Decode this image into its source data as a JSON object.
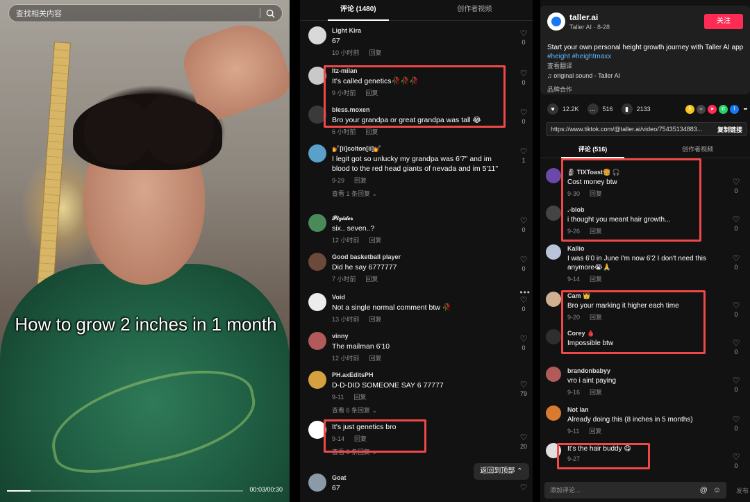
{
  "video": {
    "search_placeholder": "查找相关内容",
    "caption": "How to grow 2 inches in 1 month",
    "time": "00:03/00:30",
    "progress_fraction": 0.1
  },
  "mid": {
    "tabs": [
      {
        "label": "评论 (1480)",
        "active": true
      },
      {
        "label": "创作者视频",
        "active": false
      }
    ],
    "reply_label": "回复",
    "comments": [
      {
        "user": "Light Kira",
        "text": "67",
        "time": "10 小时前",
        "likes": "0",
        "avatar_color": "#d9d9d9"
      },
      {
        "user": "Itz-milan",
        "text": "It's called genetics🥀🥀🥀",
        "time": "9 小时前",
        "likes": "0",
        "avatar_color": "#c9c9c9"
      },
      {
        "user": "bless.moxen",
        "text": "Bro your grandpa or great grandpa was tall 😂",
        "time": "6 小时前",
        "likes": "0",
        "avatar_color": "#3a3a3a"
      },
      {
        "user": "💅[ii]colton[ii]💅",
        "text": "I legit got so unlucky my grandpa was 6'7\" and im blood to the red head giants of nevada and im 5'11\"",
        "time": "9-29",
        "likes": "1",
        "avatar_color": "#5aa0c8",
        "more": "查看 1 条回复 ⌄"
      },
      {
        "user": "𝓟𝓲𝔃𝓲𝓭𝓮𝓻",
        "text": "six.. seven..?",
        "time": "12 小时前",
        "likes": "0",
        "avatar_color": "#4a8a5a"
      },
      {
        "user": "Good basketball player",
        "text": "Did he say 6777777",
        "time": "7 小时前",
        "likes": "0",
        "avatar_color": "#6b4a3a"
      },
      {
        "user": "Void",
        "text": "Not a single normal comment btw 🥀",
        "time": "13 小时前",
        "likes": "0",
        "avatar_color": "#ececec"
      },
      {
        "user": "vinny",
        "text": "The mailman 6'10",
        "time": "12 小时前",
        "likes": "0",
        "avatar_color": "#b05a5a"
      },
      {
        "user": "PH.axEditsPH",
        "text": "D-D-DID SOMEONE SAY 6 77777",
        "time": "9-11",
        "likes": "79",
        "avatar_color": "#d4a040",
        "more": "查看 6 条回复 ⌄"
      },
      {
        "user": "",
        "text": "It's just genetics bro",
        "time": "9-14",
        "likes": "20",
        "avatar_color": "#ffffff",
        "more": "查看 3 条回复 ⌄"
      },
      {
        "user": "Goat",
        "text": "67",
        "time": "",
        "likes": "0",
        "avatar_color": "#8a9aa8"
      }
    ],
    "back_to_top": "返回到顶部 ⌃"
  },
  "right": {
    "author_name": "taller.ai",
    "author_sub": "Taller AI · 8-28",
    "follow_label": "关注",
    "desc_text": "Start your own personal height growth journey with Taller AI app",
    "desc_tags": "#height #heightmaxx",
    "translate_label": "查看翻译",
    "sound": "♫  original sound - Taller AI",
    "brand_label": "品牌合作",
    "stats": {
      "likes": "12.2K",
      "comments": "516",
      "saves": "2133"
    },
    "url": "https://www.tiktok.com/@taller.ai/video/75435134883...",
    "copy_label": "复制链接",
    "tabs": [
      {
        "label": "评论 (516)",
        "active": true
      },
      {
        "label": "创作者视频",
        "active": false
      }
    ],
    "reply_label": "回复",
    "comments": [
      {
        "user": "🗿 TIXToast🍔 🎧",
        "text": "Cost money btw",
        "time": "9-30",
        "likes": "0",
        "avatar_color": "#6a4aa8"
      },
      {
        "user": ".-blob",
        "text": "i thought you meant hair growth...",
        "time": "9-26",
        "likes": "0",
        "avatar_color": "#444444"
      },
      {
        "user": "Kallio",
        "text": "I was 6'0 in June I'm now 6'2 I don't need this anymore😭🙏",
        "time": "9-14",
        "likes": "0",
        "avatar_color": "#b8c4d8"
      },
      {
        "user": "Cam 👑",
        "text": "Bro your marking it higher each time",
        "time": "9-20",
        "likes": "0",
        "avatar_color": "#d0b090"
      },
      {
        "user": "Corey 🩸",
        "text": "Impossible btw",
        "time": "",
        "likes": "0",
        "avatar_color": "#2e2e2e"
      },
      {
        "user": "brandonbabyy",
        "text": "vro i aint paying",
        "time": "9-16",
        "likes": "0",
        "avatar_color": "#b05a5a"
      },
      {
        "user": "Not Ian",
        "text": "Already doing this (8 inches in 5 months)",
        "time": "9-11",
        "likes": "0",
        "avatar_color": "#d87a30"
      },
      {
        "user": "",
        "text": "It's the hair buddy 😋",
        "time": "9-27",
        "likes": "0",
        "avatar_color": "#e0e0e0"
      }
    ],
    "input_placeholder": "添加评论...",
    "post_label": "发布",
    "accent_color": "#fe2c55"
  }
}
